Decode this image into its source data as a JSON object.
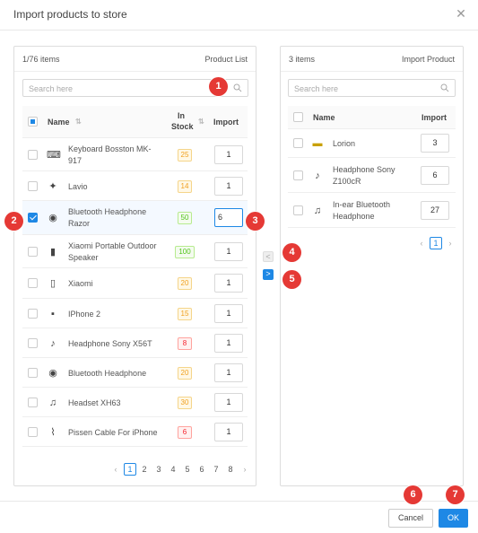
{
  "modal": {
    "title": "Import products to store",
    "close_icon": "close-icon"
  },
  "left_panel": {
    "count": "1/76 items",
    "title": "Product List",
    "search_placeholder": "Search here",
    "columns": {
      "name": "Name",
      "in_stock_1": "In",
      "in_stock_2": "Stock",
      "import": "Import"
    },
    "rows": [
      {
        "name_1": "Keyboard Bosston MK-",
        "name_2": "917",
        "stock": "25",
        "stock_color": "yellow",
        "import": "1",
        "checked": false
      },
      {
        "name_1": "Lavio",
        "name_2": "",
        "stock": "14",
        "stock_color": "yellow",
        "import": "1",
        "checked": false
      },
      {
        "name_1": "Bluetooth Headphone",
        "name_2": "Razor",
        "stock": "50",
        "stock_color": "green",
        "import": "6",
        "checked": true
      },
      {
        "name_1": "Xiaomi Portable Outdoor",
        "name_2": "Speaker",
        "stock": "100",
        "stock_color": "green",
        "import": "1",
        "checked": false
      },
      {
        "name_1": "Xiaomi",
        "name_2": "",
        "stock": "20",
        "stock_color": "yellow",
        "import": "1",
        "checked": false
      },
      {
        "name_1": "IPhone 2",
        "name_2": "",
        "stock": "15",
        "stock_color": "yellow",
        "import": "1",
        "checked": false
      },
      {
        "name_1": "Headphone Sony X56T",
        "name_2": "",
        "stock": "8",
        "stock_color": "red",
        "import": "1",
        "checked": false
      },
      {
        "name_1": "Bluetooth Headphone",
        "name_2": "",
        "stock": "20",
        "stock_color": "yellow",
        "import": "1",
        "checked": false
      },
      {
        "name_1": "Headset XH63",
        "name_2": "",
        "stock": "30",
        "stock_color": "yellow",
        "import": "1",
        "checked": false
      },
      {
        "name_1": "Pissen Cable For iPhone",
        "name_2": "",
        "stock": "6",
        "stock_color": "red",
        "import": "1",
        "checked": false
      }
    ],
    "pages": [
      "1",
      "2",
      "3",
      "4",
      "5",
      "6",
      "7",
      "8"
    ],
    "current_page": "1"
  },
  "right_panel": {
    "count": "3 items",
    "title": "Import Product",
    "search_placeholder": "Search here",
    "columns": {
      "name": "Name",
      "import": "Import"
    },
    "rows": [
      {
        "name_1": "Lorion",
        "name_2": "",
        "import": "3"
      },
      {
        "name_1": "Headphone Sony",
        "name_2": "Z100cR",
        "import": "6"
      },
      {
        "name_1": "In-ear Bluetooth",
        "name_2": "Headphone",
        "import": "27"
      }
    ],
    "pages": [
      "1"
    ]
  },
  "transfer": {
    "left": "<",
    "right": ">"
  },
  "footer": {
    "cancel": "Cancel",
    "ok": "OK"
  },
  "annotations": [
    "1",
    "2",
    "3",
    "4",
    "5",
    "6",
    "7"
  ],
  "colors": {
    "accent": "#1e88e5",
    "badge": "#e53935"
  }
}
